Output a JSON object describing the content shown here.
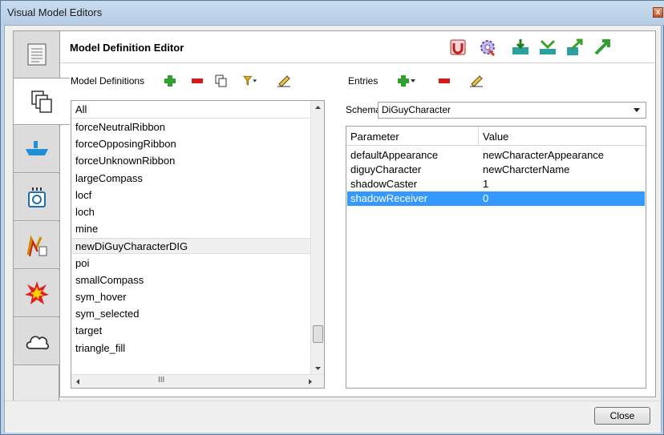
{
  "window": {
    "title": "Visual Model Editors",
    "close_glyph": "x"
  },
  "left_tabs": [
    {
      "icon": "document-list-icon"
    },
    {
      "icon": "pages-copy-icon"
    },
    {
      "icon": "ship-icon"
    },
    {
      "icon": "radio-device-icon"
    },
    {
      "icon": "path-route-icon"
    },
    {
      "icon": "explosion-icon"
    },
    {
      "icon": "cloud-icon"
    }
  ],
  "editor": {
    "title": "Model Definition Editor"
  },
  "model_definitions": {
    "label": "Model Definitions",
    "filter": "All",
    "items": [
      "forceNeutralRibbon",
      "forceOpposingRibbon",
      "forceUnknownRibbon",
      "largeCompass",
      "locf",
      "loch",
      "mine",
      "newDiGuyCharacterDIG",
      "poi",
      "smallCompass",
      "sym_hover",
      "sym_selected",
      "target",
      "triangle_fill"
    ],
    "selected": "newDiGuyCharacterDIG",
    "hscroll_grip": "III"
  },
  "entries": {
    "label": "Entries",
    "schema_label": "Schema",
    "schema_value": "DiGuyCharacter",
    "columns": [
      "Parameter",
      "Value"
    ],
    "rows": [
      {
        "parameter": "defaultAppearance",
        "value": "newCharacterAppearance"
      },
      {
        "parameter": "diguyCharacter",
        "value": "newCharcterName"
      },
      {
        "parameter": "shadowCaster",
        "value": "1"
      },
      {
        "parameter": "shadowReceiver",
        "value": "0"
      }
    ]
  },
  "footer": {
    "close_label": "Close"
  },
  "colors": {
    "selection": "#3399ff",
    "title_bar": "#bcd2ea"
  }
}
